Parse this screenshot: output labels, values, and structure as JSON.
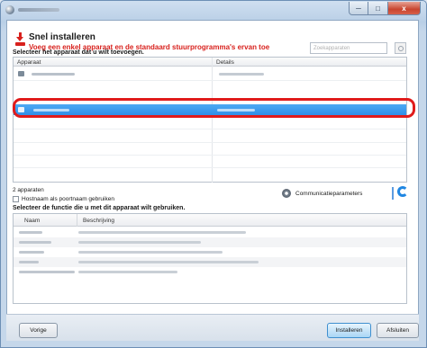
{
  "window": {
    "title": "",
    "controls": {
      "minimize": "─",
      "maximize": "□",
      "close": "x"
    }
  },
  "header": {
    "title": "Snel installeren",
    "subtitle": "Voeg een enkel apparaat en de standaard stuurprogramma's ervan toe"
  },
  "search": {
    "placeholder": "Zoekapparaten"
  },
  "devices": {
    "section_label": "Selecteer het apparaat dat u wilt toevoegen.",
    "columns": [
      "Apparaat",
      "Details"
    ],
    "rows": [
      {
        "selected": false
      },
      {
        "selected": true
      }
    ],
    "count_text": "2 apparaten",
    "hostname_checkbox": {
      "label": "Hostnaam als poortnaam gebruiken",
      "checked": false
    },
    "comm_params_label": "Communicatieparameters"
  },
  "functions": {
    "section_label": "Selecteer de functie die u met dit apparaat wilt gebruiken.",
    "columns": [
      "Naam",
      "Beschrijving"
    ],
    "row_count": 5
  },
  "footer": {
    "back_label": "Vorige",
    "install_label": "Installeren",
    "close_label": "Afsluiten"
  },
  "colors": {
    "accent_red": "#d8211d",
    "selection_blue": "#2f8fe8",
    "highlight_ring": "#e01b1b",
    "refresh_blue": "#1f86e2"
  },
  "icons": [
    "app-icon",
    "install-arrow-icon",
    "search-icon",
    "printer-icon",
    "gear-icon",
    "refresh-icon"
  ]
}
